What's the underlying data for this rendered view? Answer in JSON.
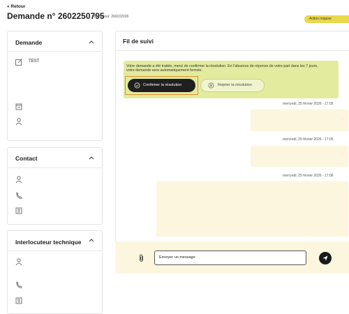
{
  "header": {
    "back_label": "« Retour",
    "title": "Demande n° 2602250795",
    "update_note": "Mise à jour: 26/02/2026",
    "action_badge": "Action requise"
  },
  "sidebar": {
    "demande": {
      "title": "Demande",
      "subject": "TEST"
    },
    "contact": {
      "title": "Contact"
    },
    "tech_contact": {
      "title": "Interlocuteur technique"
    }
  },
  "thread": {
    "title": "Fil de suivi",
    "notice": "Votre demande a été traitée, merci de confirmer la résolution. En l'absence de réponse de votre part dans les 7 jours, votre demande sera automatiquement fermée.",
    "confirm_label": "Confirmer la résolution",
    "reject_label": "Rejeter la résolution",
    "messages": [
      {
        "timestamp": "mercredi, 25 février 2026 - 17:05"
      },
      {
        "timestamp": "mercredi, 25 février 2026 - 17:05"
      },
      {
        "timestamp": "mercredi, 25 février 2026 - 17:06"
      }
    ]
  },
  "composer": {
    "placeholder": "Envoyer un message"
  },
  "colors": {
    "accent_yellow": "#e8d84a",
    "notice_bg": "#e2eb9e",
    "bubble_bg": "#fbf6dd",
    "highlight": "#e58a2d"
  }
}
